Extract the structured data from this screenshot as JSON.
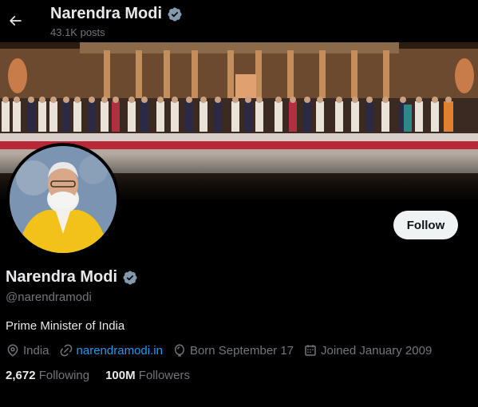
{
  "header": {
    "name": "Narendra Modi",
    "posts": "43.1K posts"
  },
  "profile": {
    "name": "Narendra Modi",
    "handle": "@narendramodi",
    "bio": "Prime Minister of India",
    "location": "India",
    "website": "narendramodi.in",
    "birthday": "Born September 17",
    "joined": "Joined January 2009",
    "following_count": "2,672",
    "following_label": "Following",
    "followers_count": "100M",
    "followers_label": "Followers"
  },
  "actions": {
    "follow_label": "Follow"
  },
  "colors": {
    "background": "#000000",
    "accent": "#1d9bf0",
    "verified_badge": "#829aab",
    "muted_text": "#71767b"
  },
  "icons": {
    "back": "arrow-left-icon",
    "verified": "verified-badge-icon",
    "location": "location-pin-icon",
    "website": "link-icon",
    "birthday": "balloon-icon",
    "joined": "calendar-icon"
  }
}
